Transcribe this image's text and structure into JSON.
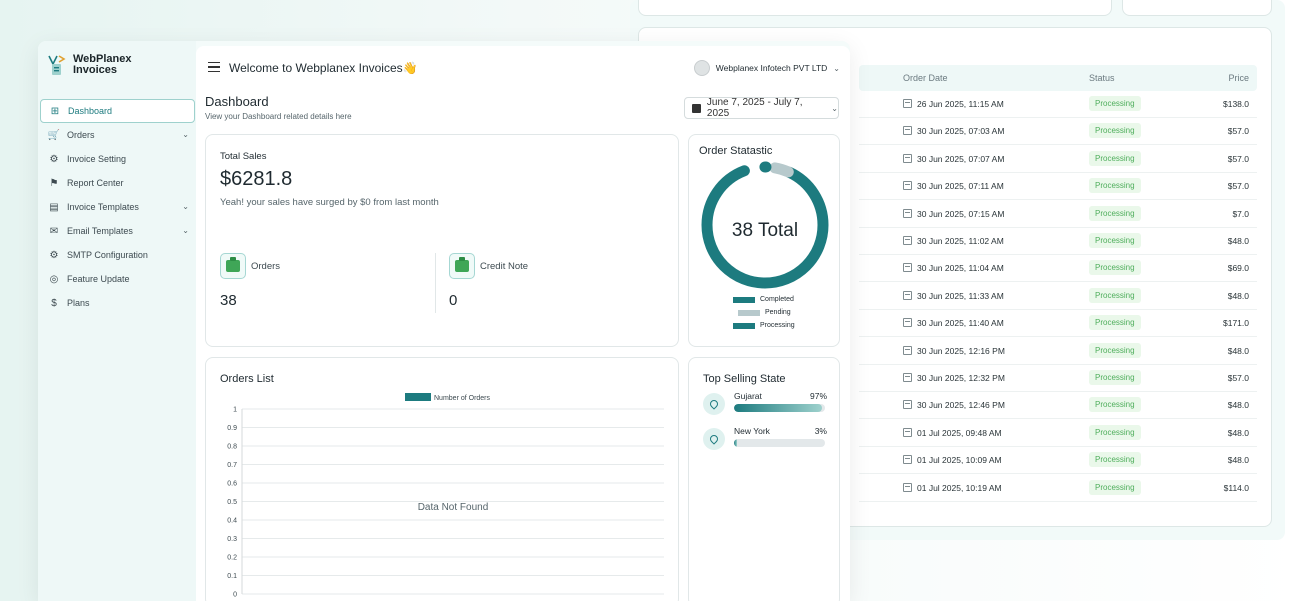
{
  "background_table": {
    "headers": {
      "order_date": "Order Date",
      "status": "Status",
      "price": "Price"
    },
    "rows": [
      {
        "date": "26 Jun 2025, 11:15 AM",
        "status": "Processing",
        "price": "$138.0"
      },
      {
        "date": "30 Jun 2025, 07:03 AM",
        "status": "Processing",
        "price": "$57.0"
      },
      {
        "date": "30 Jun 2025, 07:07 AM",
        "status": "Processing",
        "price": "$57.0"
      },
      {
        "date": "30 Jun 2025, 07:11 AM",
        "status": "Processing",
        "price": "$57.0"
      },
      {
        "date": "30 Jun 2025, 07:15 AM",
        "status": "Processing",
        "price": "$7.0"
      },
      {
        "date": "30 Jun 2025, 11:02 AM",
        "status": "Processing",
        "price": "$48.0"
      },
      {
        "date": "30 Jun 2025, 11:04 AM",
        "status": "Processing",
        "price": "$69.0"
      },
      {
        "date": "30 Jun 2025, 11:33 AM",
        "status": "Processing",
        "price": "$48.0"
      },
      {
        "date": "30 Jun 2025, 11:40 AM",
        "status": "Processing",
        "price": "$171.0"
      },
      {
        "date": "30 Jun 2025, 12:16 PM",
        "status": "Processing",
        "price": "$48.0"
      },
      {
        "date": "30 Jun 2025, 12:32 PM",
        "status": "Processing",
        "price": "$57.0"
      },
      {
        "date": "30 Jun 2025, 12:46 PM",
        "status": "Processing",
        "price": "$48.0"
      },
      {
        "date": "01 Jul 2025, 09:48 AM",
        "status": "Processing",
        "price": "$48.0"
      },
      {
        "date": "01 Jul 2025, 10:09 AM",
        "status": "Processing",
        "price": "$48.0"
      },
      {
        "date": "01 Jul 2025, 10:19 AM",
        "status": "Processing",
        "price": "$114.0"
      }
    ]
  },
  "brand": {
    "line1": "WebPlanex",
    "line2": "Invoices"
  },
  "sidebar": {
    "items": [
      {
        "label": "Dashboard",
        "icon": "grid-icon",
        "glyph": "⊞",
        "active": true,
        "chevron": false
      },
      {
        "label": "Orders",
        "icon": "cart-icon",
        "glyph": "🛒",
        "active": false,
        "chevron": true
      },
      {
        "label": "Invoice Setting",
        "icon": "gear-icon",
        "glyph": "⚙",
        "active": false,
        "chevron": false
      },
      {
        "label": "Report Center",
        "icon": "flag-icon",
        "glyph": "⚑",
        "active": false,
        "chevron": false
      },
      {
        "label": "Invoice Templates",
        "icon": "template-icon",
        "glyph": "▤",
        "active": false,
        "chevron": true
      },
      {
        "label": "Email Templates",
        "icon": "mail-icon",
        "glyph": "✉",
        "active": false,
        "chevron": true
      },
      {
        "label": "SMTP Configuration",
        "icon": "mail-settings-icon",
        "glyph": "⚙",
        "active": false,
        "chevron": false
      },
      {
        "label": "Feature Update",
        "icon": "update-icon",
        "glyph": "◎",
        "active": false,
        "chevron": false
      },
      {
        "label": "Plans",
        "icon": "dollar-icon",
        "glyph": "$",
        "active": false,
        "chevron": false
      }
    ]
  },
  "topbar": {
    "welcome": "Welcome to Webplanex Invoices👋",
    "user": "Webplanex Infotech PVT LTD"
  },
  "page": {
    "title": "Dashboard",
    "subtitle": "View your Dashboard related details here",
    "date_range": "June 7, 2025 - July 7, 2025"
  },
  "sales": {
    "label": "Total Sales",
    "value": "$6281.8",
    "note": "Yeah! your sales have surged by $0 from last month",
    "orders_label": "Orders",
    "orders_value": "38",
    "credit_label": "Credit Note",
    "credit_value": "0"
  },
  "order_stat": {
    "title": "Order Statastic",
    "total": "38 Total",
    "legend": [
      {
        "name": "Completed",
        "color": "#1d7b7f"
      },
      {
        "name": "Pending",
        "color": "#b7c9cc"
      },
      {
        "name": "Processing",
        "color": "#1d7b7f"
      }
    ]
  },
  "orders_list": {
    "title": "Orders List"
  },
  "chart_data": {
    "type": "bar",
    "categories": [],
    "series": [
      {
        "name": "Number of Orders",
        "values": []
      }
    ],
    "y_ticks": [
      "1",
      "0.9",
      "0.8",
      "0.7",
      "0.6",
      "0.5",
      "0.4",
      "0.3",
      "0.2",
      "0.1",
      "0"
    ],
    "ylim": [
      0,
      1
    ],
    "empty_text": "Data Not Found",
    "series_color": "#1d7b7f"
  },
  "top_selling": {
    "title": "Top Selling State",
    "states": [
      {
        "name": "Gujarat",
        "pct_label": "97%",
        "pct": 97
      },
      {
        "name": "New York",
        "pct_label": "3%",
        "pct": 3
      }
    ]
  },
  "colors": {
    "accent": "#1d7b7f",
    "status_green": "#4fae5c"
  }
}
